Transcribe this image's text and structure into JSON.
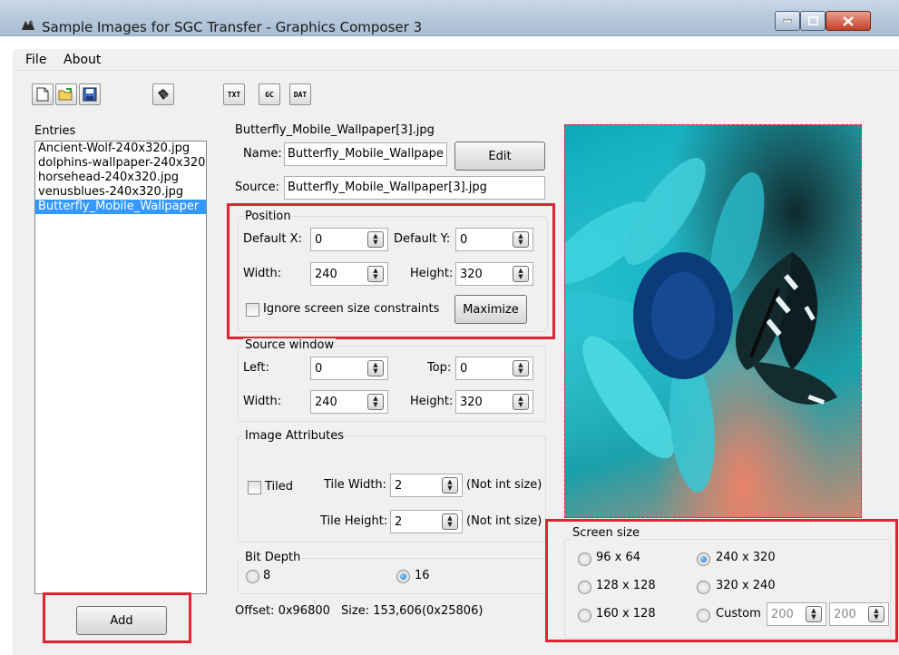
{
  "window": {
    "title": "Sample Images for SGC Transfer - Graphics Composer 3"
  },
  "menu": {
    "file": "File",
    "about": "About"
  },
  "toolbar": {
    "txt": "TXT",
    "gc": "GC",
    "dat": "DAT"
  },
  "entries": {
    "label": "Entries",
    "items": [
      "Ancient-Wolf-240x320.jpg",
      "dolphins-wallpaper-240x320",
      "horsehead-240x320.jpg",
      "venusblues-240x320.jpg",
      "Butterfly_Mobile_Wallpaper"
    ],
    "selected_index": 4,
    "add_label": "Add"
  },
  "details": {
    "filename": "Butterfly_Mobile_Wallpaper[3].jpg",
    "name_label": "Name:",
    "name_value": "Butterfly_Mobile_Wallpape",
    "edit_label": "Edit",
    "source_label": "Source:",
    "source_value": "Butterfly_Mobile_Wallpaper[3].jpg"
  },
  "position": {
    "title": "Position",
    "default_x_label": "Default X:",
    "default_x": "0",
    "default_y_label": "Default Y:",
    "default_y": "0",
    "width_label": "Width:",
    "width": "240",
    "height_label": "Height:",
    "height": "320",
    "ignore_label": "Ignore screen size constraints",
    "maximize_label": "Maximize"
  },
  "source_window": {
    "title": "Source window",
    "left_label": "Left:",
    "left": "0",
    "top_label": "Top:",
    "top": "0",
    "width_label": "Width:",
    "width": "240",
    "height_label": "Height:",
    "height": "320"
  },
  "image_attributes": {
    "title": "Image Attributes",
    "tiled_label": "Tiled",
    "tile_width_label": "Tile Width:",
    "tile_width": "2",
    "tile_width_note": "(Not int size)",
    "tile_height_label": "Tile Height:",
    "tile_height": "2",
    "tile_height_note": "(Not int size)"
  },
  "bit_depth": {
    "title": "Bit Depth",
    "opt8": "8",
    "opt16": "16",
    "selected": "16"
  },
  "status": {
    "offset": "Offset: 0x96800",
    "size": "Size: 153,606(0x25806)"
  },
  "screen_size": {
    "title": "Screen size",
    "opt_96x64": "96 x 64",
    "opt_240x320": "240 x 320",
    "opt_128x128": "128 x 128",
    "opt_320x240": "320 x 240",
    "opt_160x128": "160 x 128",
    "opt_custom": "Custom",
    "custom_w": "200",
    "custom_h": "200",
    "selected": "240 x 320"
  },
  "colors": {
    "highlight_red": "#e0232e",
    "selection_blue": "#3399ff"
  }
}
